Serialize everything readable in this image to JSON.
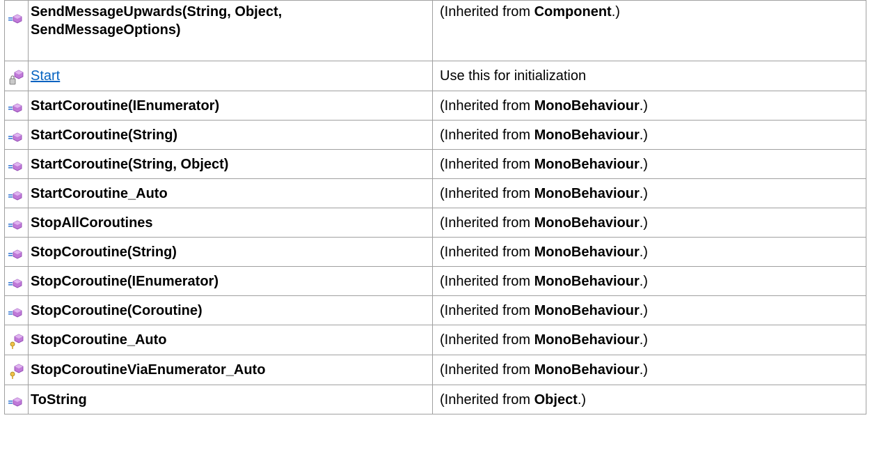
{
  "members": [
    {
      "icon": "public-method-icon",
      "name": "SendMessageUpwards(String, Object, SendMessageOptions)",
      "desc_prefix": "(Inherited from ",
      "desc_bold": "Component",
      "desc_suffix": ".)"
    },
    {
      "icon": "protected-method-icon",
      "name": "Start",
      "link": true,
      "desc": "Use this for initialization"
    },
    {
      "icon": "public-method-icon",
      "name": "StartCoroutine(IEnumerator)",
      "desc_prefix": "(Inherited from ",
      "desc_bold": "MonoBehaviour",
      "desc_suffix": ".)"
    },
    {
      "icon": "public-method-icon",
      "name": "StartCoroutine(String)",
      "desc_prefix": "(Inherited from ",
      "desc_bold": "MonoBehaviour",
      "desc_suffix": ".)"
    },
    {
      "icon": "public-method-icon",
      "name": "StartCoroutine(String, Object)",
      "desc_prefix": "(Inherited from ",
      "desc_bold": "MonoBehaviour",
      "desc_suffix": ".)"
    },
    {
      "icon": "public-method-icon",
      "name": "StartCoroutine_Auto",
      "desc_prefix": "(Inherited from ",
      "desc_bold": "MonoBehaviour",
      "desc_suffix": ".)"
    },
    {
      "icon": "public-method-icon",
      "name": "StopAllCoroutines",
      "desc_prefix": "(Inherited from ",
      "desc_bold": "MonoBehaviour",
      "desc_suffix": ".)"
    },
    {
      "icon": "public-method-icon",
      "name": "StopCoroutine(String)",
      "desc_prefix": "(Inherited from ",
      "desc_bold": "MonoBehaviour",
      "desc_suffix": ".)"
    },
    {
      "icon": "public-method-icon",
      "name": "StopCoroutine(IEnumerator)",
      "desc_prefix": "(Inherited from ",
      "desc_bold": "MonoBehaviour",
      "desc_suffix": ".)"
    },
    {
      "icon": "public-method-icon",
      "name": "StopCoroutine(Coroutine)",
      "desc_prefix": "(Inherited from ",
      "desc_bold": "MonoBehaviour",
      "desc_suffix": ".)"
    },
    {
      "icon": "internal-method-icon",
      "name": "StopCoroutine_Auto",
      "desc_prefix": "(Inherited from ",
      "desc_bold": "MonoBehaviour",
      "desc_suffix": ".)"
    },
    {
      "icon": "internal-method-icon",
      "name": "StopCoroutineViaEnumerator_Auto",
      "desc_prefix": "(Inherited from ",
      "desc_bold": "MonoBehaviour",
      "desc_suffix": ".)"
    },
    {
      "icon": "public-method-icon",
      "name": "ToString",
      "desc_prefix": "(Inherited from ",
      "desc_bold": "Object",
      "desc_suffix": ".)"
    }
  ]
}
